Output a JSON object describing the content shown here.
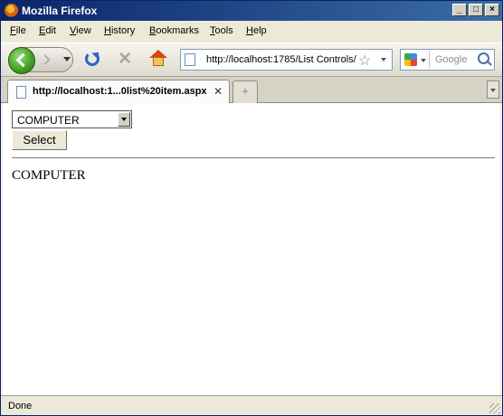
{
  "window": {
    "title": "Mozilla Firefox"
  },
  "menubar": {
    "items": [
      {
        "label": "File",
        "accel": "F",
        "rest": "ile"
      },
      {
        "label": "Edit",
        "accel": "E",
        "rest": "dit"
      },
      {
        "label": "View",
        "accel": "V",
        "rest": "iew"
      },
      {
        "label": "History",
        "accel": "H",
        "rest": "istory"
      },
      {
        "label": "Bookmarks",
        "accel": "B",
        "rest": "ookmarks"
      },
      {
        "label": "Tools",
        "accel": "T",
        "rest": "ools"
      },
      {
        "label": "Help",
        "accel": "H",
        "rest": "elp"
      }
    ]
  },
  "navigation": {
    "url": "http://localhost:1785/List Controls/",
    "search_placeholder": "Google"
  },
  "tabs": [
    {
      "label": "http://localhost:1...0list%20item.aspx",
      "active": true
    }
  ],
  "page": {
    "select": {
      "value": "COMPUTER"
    },
    "button_label": "Select",
    "result_text": "COMPUTER"
  },
  "statusbar": {
    "text": "Done"
  },
  "colors": {
    "titlebar_start": "#0a246a",
    "titlebar_end": "#3a6ea5",
    "chrome": "#ece9d8"
  }
}
